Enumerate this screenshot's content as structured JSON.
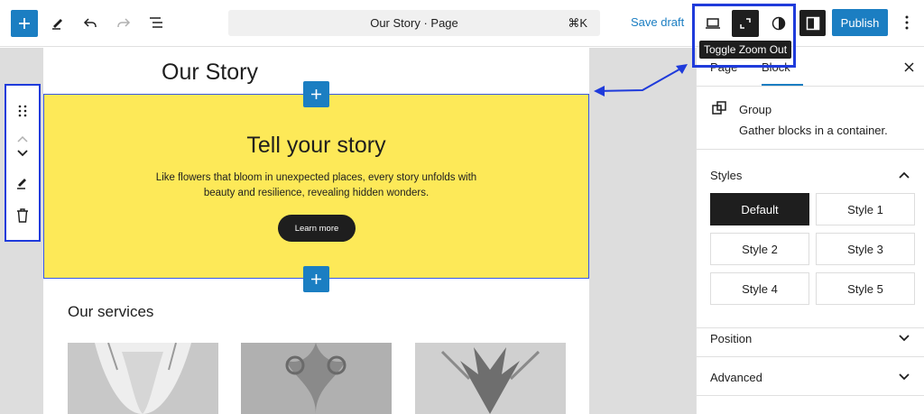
{
  "topbar": {
    "inserter_label": "+",
    "document_title": "Our Story · Page",
    "shortcut": "⌘K",
    "save_draft": "Save draft",
    "publish": "Publish",
    "tooltip": "Toggle Zoom Out"
  },
  "canvas": {
    "page_title": "Our Story",
    "group": {
      "heading": "Tell your story",
      "text": "Like flowers that bloom in unexpected places, every story unfolds with beauty and resilience, revealing hidden wonders.",
      "button": "Learn more",
      "background": "#fde958"
    },
    "services_heading": "Our services"
  },
  "sidebar": {
    "tabs": [
      {
        "label": "Page"
      },
      {
        "label": "Block"
      }
    ],
    "block": {
      "title": "Group",
      "description": "Gather blocks in a container."
    },
    "styles": {
      "title": "Styles",
      "options": [
        "Default",
        "Style 1",
        "Style 2",
        "Style 3",
        "Style 4",
        "Style 5"
      ],
      "selected": "Default"
    },
    "position": {
      "title": "Position"
    },
    "advanced": {
      "title": "Advanced"
    }
  },
  "colors": {
    "accent": "#1b7ec2",
    "highlight": "#1f3bdb",
    "dark": "#1e1e1e"
  },
  "icons": {
    "inserter": "plus-icon",
    "tools": "pencil-icon",
    "undo": "undo-icon",
    "redo": "redo-icon",
    "list_view": "list-view-icon",
    "desktop": "desktop-icon",
    "zoom_out": "zoom-out-icon",
    "style": "contrast-icon",
    "settings": "sidebar-icon",
    "options": "more-vertical-icon"
  }
}
